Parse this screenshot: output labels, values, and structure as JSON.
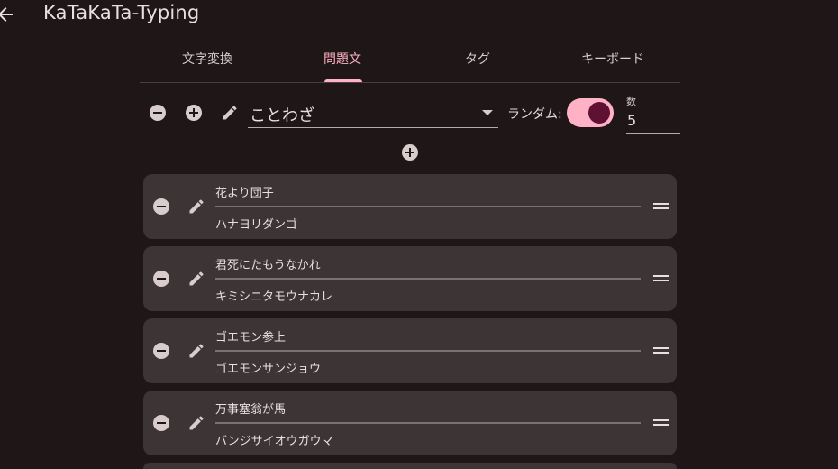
{
  "app": {
    "title": "KaTaKaTa-Typing"
  },
  "tabs": [
    {
      "label": "文字変換"
    },
    {
      "label": "問題文"
    },
    {
      "label": "タグ"
    },
    {
      "label": "キーボード"
    }
  ],
  "active_tab": 1,
  "toolbar": {
    "category": "ことわざ",
    "random_label": "ランダム:",
    "random_enabled": true,
    "count_label": "数",
    "count_value": "5"
  },
  "questions": [
    {
      "text": "花より団子",
      "reading": "ハナヨリダンゴ"
    },
    {
      "text": "君死にたもうなかれ",
      "reading": "キミシニタモウナカレ"
    },
    {
      "text": "ゴエモン参上",
      "reading": "ゴエモンサンジョウ"
    },
    {
      "text": "万事塞翁が馬",
      "reading": "バンジサイオウガウマ"
    }
  ],
  "colors": {
    "background": "#1e1617",
    "accent": "#ffb1c5",
    "card": "#3c3435",
    "toggle_knob": "#5e1133"
  },
  "icons": {
    "back": "arrow-back-icon",
    "remove": "remove-circle-icon",
    "add": "add-circle-icon",
    "edit": "pencil-icon",
    "reorder": "drag-handle-icon"
  }
}
